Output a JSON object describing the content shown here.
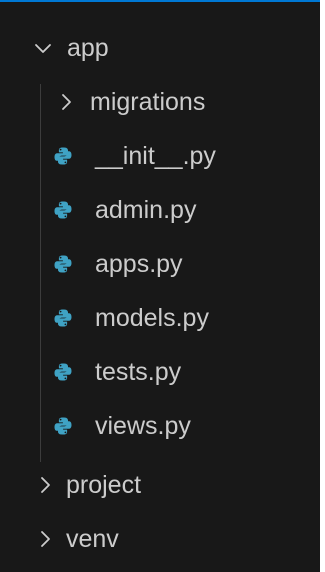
{
  "colors": {
    "background": "#181818",
    "text": "#cccccc",
    "python_icon": "#3fa2c4",
    "focus_border": "#0078d4"
  },
  "tree": {
    "app": {
      "label": "app",
      "icon": "chevron-down-icon",
      "expanded": true
    },
    "children": [
      {
        "label": "migrations",
        "icon": "chevron-right-icon",
        "expanded": false
      },
      {
        "label": "__init__.py",
        "icon": "python-file-icon"
      },
      {
        "label": "admin.py",
        "icon": "python-file-icon"
      },
      {
        "label": "apps.py",
        "icon": "python-file-icon"
      },
      {
        "label": "models.py",
        "icon": "python-file-icon"
      },
      {
        "label": "tests.py",
        "icon": "python-file-icon"
      },
      {
        "label": "views.py",
        "icon": "python-file-icon"
      }
    ],
    "project": {
      "label": "project",
      "icon": "chevron-right-icon",
      "expanded": false
    },
    "venv": {
      "label": "venv",
      "icon": "chevron-right-icon",
      "expanded": false
    }
  }
}
